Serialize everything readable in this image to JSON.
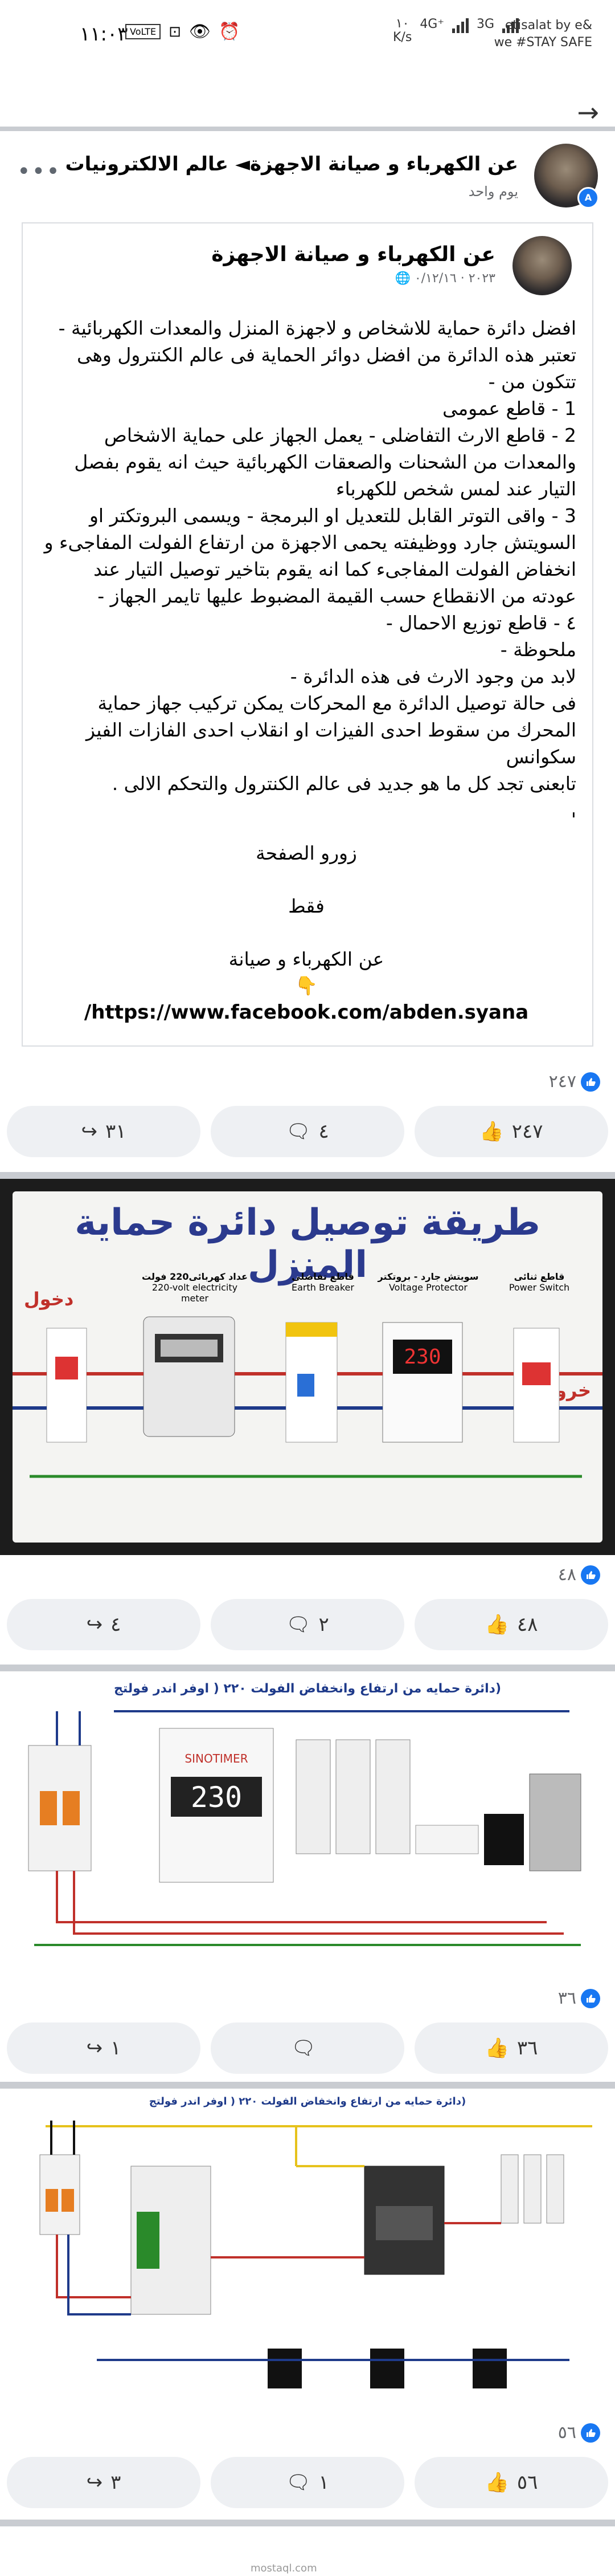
{
  "status_bar": {
    "time": "١١:٠٣",
    "speed_top": "١٠",
    "speed_unit": "K/s",
    "net_4g": "4G⁺",
    "net_3g": "3G",
    "carrier": "etisalat by e&",
    "carrier_sub": "we #STAY SAFE"
  },
  "nav": {
    "back_label": "→"
  },
  "post": {
    "page_name": "عن الكهرباء و صيانة الاجهزة◄ عالم الالكترونيات",
    "time": "يوم واحد",
    "more": "•••"
  },
  "shared": {
    "page_name": "عن الكهرباء و صيانة الاجهزة",
    "date": "٢٠٢٣ · ٠/١٢/١٦",
    "body_lines": [
      "افضل دائرة حماية للاشخاص و لاجهزة  المنزل والمعدات الكهربائية -",
      "تعتبر هذه الدائرة من افضل دوائر الحماية فى عالم الكنترول وهى",
      "تتكون من -",
      "1  -  قاطع عمومى",
      "2 - قاطع الارث التفاضلى - يعمل الجهاز على حماية الاشخاص",
      "والمعدات من  الشحنات والصعقات الكهربائية  حيث  انه يقوم بفصل",
      "التيار عند لمس شخص للكهرباء",
      "3 - واقى التوتر القابل للتعديل او البرمجة - ويسمى البروتكتر او",
      "السويتش جارد ووظيفته يحمى الاجهزة من ارتفاع الفولت المفاجىء  و",
      "انخفاض الفولت المفاجىء كما انه يقوم بتاخير توصيل التيار عند",
      "عودته من الانقطاع  حسب القيمة المضبوط عليها تايمر الجهاز -",
      "٤ - قاطع توزيع الاحمال -",
      "ملحوظة -",
      "لابد من وجود الارث فى هذه الدائرة -",
      "فى حالة توصيل الدائرة مع المحركات يمكن تركيب جهاز حماية",
      "المحرك من سقوط احدى الفيزات او انقلاب احدى الفازات  الفيز",
      "سكوانس",
      "تابعنى تجد كل ما هو جديد فى عالم الكنترول والتحكم الالى  ."
    ],
    "dot": "'",
    "visit": "زورو الصفحة",
    "only": "فقط",
    "page_ref": "عن الكهرباء و صيانة",
    "pointing": "👇",
    "link": "/https://www.facebook.com/abden.syana"
  },
  "posts": [
    {
      "likes": "٢٤٧",
      "shares": "٣١",
      "comments": "٤",
      "like_count": "٢٤٧"
    },
    {
      "likes": "٤٨",
      "shares": "٤",
      "comments": "٢",
      "like_count": "٤٨"
    },
    {
      "likes": "٣٦",
      "shares": "١",
      "comments": "",
      "like_count": "٣٦"
    },
    {
      "likes": "٥٦",
      "shares": "٣",
      "comments": "١",
      "like_count": "٥٦"
    }
  ],
  "image1": {
    "title": "طريقة توصيل دائرة حماية المنزل",
    "in_label": "دخول",
    "out_label": "خروج",
    "meter_ar": "عداد كهربائى220 فولت",
    "meter_en": "220-volt electricity meter",
    "breaker_ar": "قاطع تفاضلى",
    "breaker_en": "Earth Breaker",
    "protector_ar": "سويتش جارد - بروتكتر",
    "protector_en": "Voltage Protector",
    "switch_ar": "قاطع ثنائى",
    "switch_en": "Power Switch",
    "display": "230"
  },
  "image2": {
    "title": "(دائرة حمايه من ارتفاع وانخفاض الفولت ٢٢٠ ( اوفر اندر فولتج",
    "display": "230",
    "brand": "SINOTIMER"
  },
  "image3": {
    "title": "(دائرة حمايه من ارتفاع وانخفاض الفولت ٢٢٠ ( اوفر اندر فولتج"
  },
  "colors": {
    "accent": "#1877f2",
    "divider": "#c9ccd1",
    "button_bg": "#eef0f3"
  },
  "footer": {
    "watermark": "mostaql.com"
  }
}
